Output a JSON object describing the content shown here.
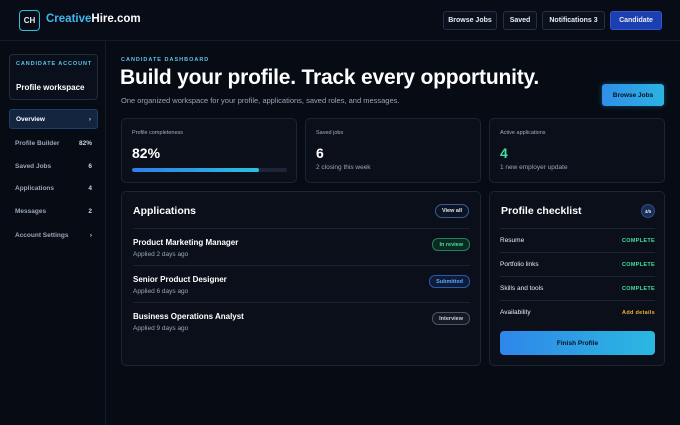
{
  "header": {
    "logo_text": "CH",
    "brand_part1": "Creative",
    "brand_part2": "Hire.com",
    "nav": [
      {
        "label": "Browse Jobs"
      },
      {
        "label": "Saved"
      },
      {
        "label": "Notifications 3"
      },
      {
        "label": "Candidate"
      }
    ]
  },
  "sidebar": {
    "eyebrow": "CANDIDATE ACCOUNT",
    "title": "Profile workspace",
    "items": [
      {
        "label": "Overview",
        "count": "›"
      },
      {
        "label": "Profile Builder",
        "count": "82%"
      },
      {
        "label": "Saved Jobs",
        "count": "6"
      },
      {
        "label": "Applications",
        "count": "4"
      },
      {
        "label": "Messages",
        "count": "2"
      },
      {
        "label": "Account Settings",
        "count": "›"
      }
    ]
  },
  "main": {
    "eyebrow": "CANDIDATE DASHBOARD",
    "title": "Build your profile. Track every opportunity.",
    "subtitle": "One organized workspace for your profile, applications, saved roles, and messages.",
    "cta_label": "Browse Jobs"
  },
  "stats": {
    "completeness": {
      "label": "Profile completeness",
      "value": "82%",
      "progress": 0.82
    },
    "saved": {
      "label": "Saved jobs",
      "value": "6",
      "sub": "2 closing this week"
    },
    "active": {
      "label": "Active applications",
      "value": "4",
      "sub": "1 new employer update"
    }
  },
  "applications": {
    "title": "Applications",
    "view_all": "View all",
    "rows": [
      {
        "role": "Product Marketing Manager",
        "meta": "Applied 2 days ago",
        "status": "In review"
      },
      {
        "role": "Senior Product Designer",
        "meta": "Applied 6 days ago",
        "status": "Submitted"
      },
      {
        "role": "Business Operations Analyst",
        "meta": "Applied 9 days ago",
        "status": "Interview"
      }
    ]
  },
  "checklist": {
    "title": "Profile checklist",
    "count": "4/5",
    "items": [
      {
        "label": "Resume",
        "status": "COMPLETE"
      },
      {
        "label": "Portfolio links",
        "status": "COMPLETE"
      },
      {
        "label": "Skills and tools",
        "status": "COMPLETE"
      },
      {
        "label": "Availability",
        "status": "Add details"
      }
    ],
    "button": "Finish Profile"
  },
  "colors": {
    "accent": "#2bc1e0",
    "primary_nav": "#1b3fb0",
    "complete": "#3fe0a0",
    "pending": "#f0b030",
    "review_green": "#3fe0a0",
    "submitted_blue": "#5ca8ff",
    "interview_gray": "#c8d0dc"
  }
}
